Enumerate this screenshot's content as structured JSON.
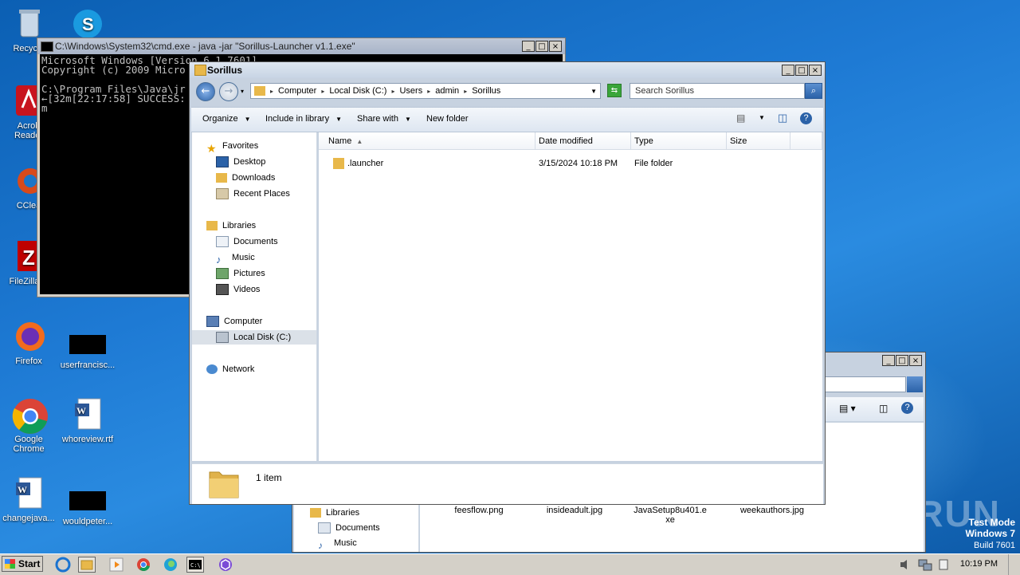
{
  "desktop": {
    "icons": [
      {
        "label": "Recycle",
        "name": "recycle-bin-icon"
      },
      {
        "label": "Acrob\nReader",
        "name": "acrobat-reader-icon"
      },
      {
        "label": "CClea",
        "name": "ccleaner-icon"
      },
      {
        "label": "FileZilla C",
        "name": "filezilla-icon"
      },
      {
        "label": "Firefox",
        "name": "firefox-icon"
      },
      {
        "label": "userfrancisc...",
        "name": "file-icon"
      },
      {
        "label": "Google\nChrome",
        "name": "chrome-icon"
      },
      {
        "label": "whoreview.rtf",
        "name": "word-document-icon"
      },
      {
        "label": "changejava...",
        "name": "word-document-icon"
      },
      {
        "label": "wouldpeter...",
        "name": "file-icon"
      }
    ]
  },
  "cmd": {
    "title": "C:\\Windows\\System32\\cmd.exe - java  -jar \"Sorillus-Launcher v1.1.exe\"",
    "lines": "Microsoft Windows [Version 6.1.7601]\nCopyright (c) 2009 Micro\n\nC:\\Program Files\\Java\\jr\n←[32m[22:17:58] SUCCESS:\nm"
  },
  "explorer": {
    "title": "Sorillus",
    "breadcrumbs": [
      "Computer",
      "Local Disk (C:)",
      "Users",
      "admin",
      "Sorillus"
    ],
    "search_placeholder": "Search Sorillus",
    "toolbar": {
      "organize": "Organize",
      "include": "Include in library",
      "share": "Share with",
      "new_folder": "New folder"
    },
    "nav": {
      "favorites": "Favorites",
      "desktop": "Desktop",
      "downloads": "Downloads",
      "recent": "Recent Places",
      "libraries": "Libraries",
      "documents": "Documents",
      "music": "Music",
      "pictures": "Pictures",
      "videos": "Videos",
      "computer": "Computer",
      "local_disk": "Local Disk (C:)",
      "network": "Network"
    },
    "columns": {
      "name": "Name",
      "date": "Date modified",
      "type": "Type",
      "size": "Size"
    },
    "files": [
      {
        "name": ".launcher",
        "date": "3/15/2024 10:18 PM",
        "type": "File folder",
        "size": ""
      }
    ],
    "status": "1 item"
  },
  "explorer_bg": {
    "nav": {
      "libraries": "Libraries",
      "documents": "Documents",
      "music": "Music"
    },
    "files": [
      "feesflow.png",
      "insideadult.jpg",
      "JavaSetup8u401.e\nxe",
      "weekauthors.jpg"
    ]
  },
  "taskbar": {
    "start": "Start",
    "clock": "10:19 PM"
  },
  "watermark": "ANY RUN",
  "testmode": {
    "line1": "Test Mode",
    "line2": "Windows 7",
    "line3": "Build 7601"
  }
}
